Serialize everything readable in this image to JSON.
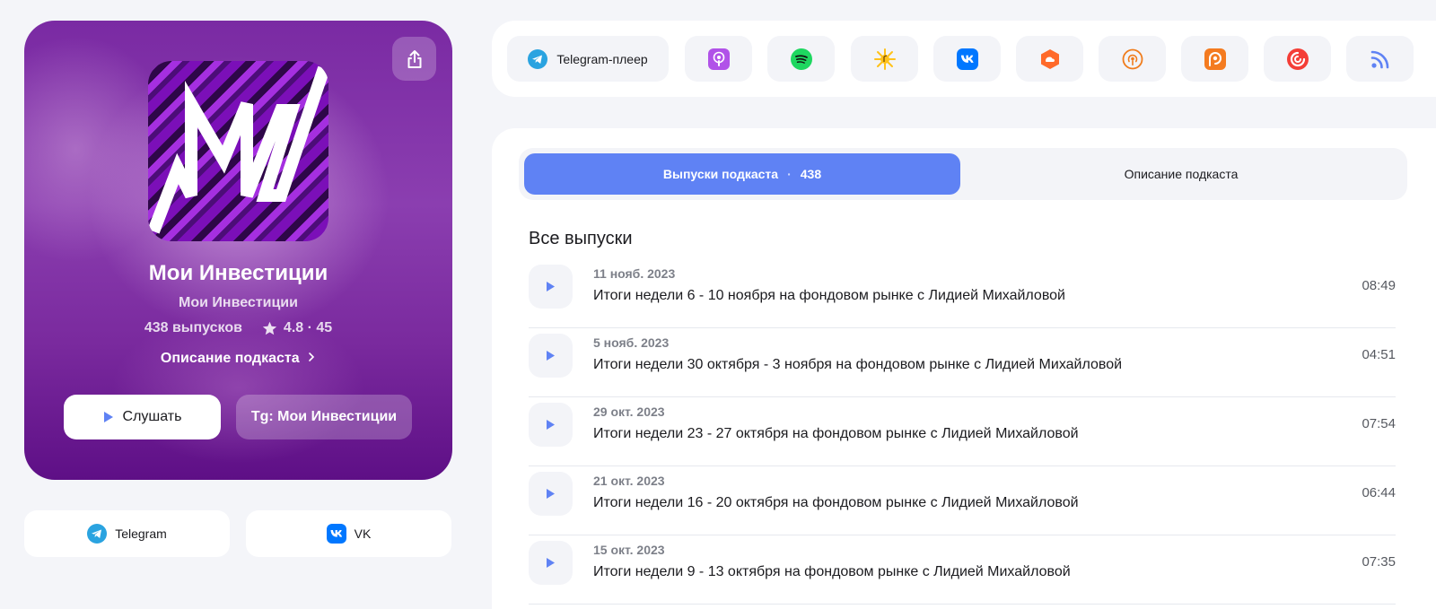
{
  "podcast": {
    "title": "Мои Инвестиции",
    "author": "Мои Инвестиции",
    "episodes_count_label": "438 выпусков",
    "rating_label": "4.8 · 45",
    "description_link": "Описание подкаста",
    "listen_label": "Слушать",
    "telegram_channel_label": "Tg: Мои Инвестиции"
  },
  "social_links": [
    {
      "label": "Telegram",
      "icon": "telegram-icon"
    },
    {
      "label": "VK",
      "icon": "vk-icon"
    }
  ],
  "platforms": [
    {
      "label": "Telegram-плеер",
      "icon": "telegram-icon",
      "color": "#2aa3e0"
    },
    {
      "label": "",
      "icon": "apple-podcasts-icon",
      "color": "#b152e8"
    },
    {
      "label": "",
      "icon": "spotify-icon",
      "color": "#1ed760"
    },
    {
      "label": "",
      "icon": "yandex-music-icon",
      "color": "#ffc21a"
    },
    {
      "label": "",
      "icon": "vk-icon",
      "color": "#0077ff"
    },
    {
      "label": "",
      "icon": "soundstream-icon",
      "color": "#ff6a2a"
    },
    {
      "label": "",
      "icon": "podcast-antenna-icon",
      "color": "#f07c1c"
    },
    {
      "label": "",
      "icon": "podcast-addict-icon",
      "color": "#f47b20"
    },
    {
      "label": "",
      "icon": "pocket-casts-icon",
      "color": "#f43e37"
    },
    {
      "label": "",
      "icon": "rss-icon",
      "color": "#5f82f4"
    }
  ],
  "tabs": {
    "episodes_label": "Выпуски подкаста",
    "episodes_separator": "·",
    "episodes_count": "438",
    "description_label": "Описание подкаста"
  },
  "section_title": "Все выпуски",
  "episodes": [
    {
      "date": "11 нояб. 2023",
      "title": "Итоги недели 6 - 10 ноября на фондовом рынке с Лидией Михайловой",
      "duration": "08:49"
    },
    {
      "date": "5 нояб. 2023",
      "title": "Итоги недели 30 октября - 3 ноября на фондовом рынке с Лидией Михайловой",
      "duration": "04:51"
    },
    {
      "date": "29 окт. 2023",
      "title": "Итоги недели 23 - 27 октября на фондовом рынке с Лидией Михайловой",
      "duration": "07:54"
    },
    {
      "date": "21 окт. 2023",
      "title": "Итоги недели 16 - 20 октября на фондовом рынке с Лидией Михайловой",
      "duration": "06:44"
    },
    {
      "date": "15 окт. 2023",
      "title": "Итоги недели 9 - 13 октября на фондовом рынке с Лидией Михайловой",
      "duration": "07:35"
    }
  ],
  "colors": {
    "accent": "#5f82f4",
    "card_purple": "#7a2aa3"
  }
}
